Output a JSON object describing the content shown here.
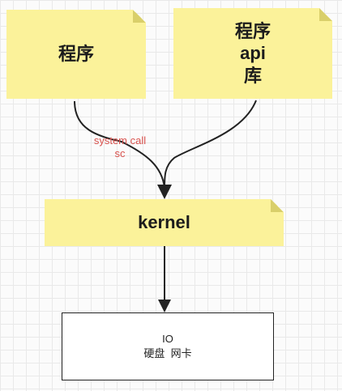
{
  "notes": {
    "program": "程序",
    "api_lines": [
      "程序",
      "api",
      "库"
    ],
    "kernel": "kernel"
  },
  "edge_label": {
    "line1": "system call",
    "line2": "sc"
  },
  "io_box": {
    "line1": "IO",
    "line2": "硬盘  网卡"
  },
  "colors": {
    "note_fill": "#fbf29a",
    "label_red": "#d9534f",
    "arrow": "#222222"
  }
}
